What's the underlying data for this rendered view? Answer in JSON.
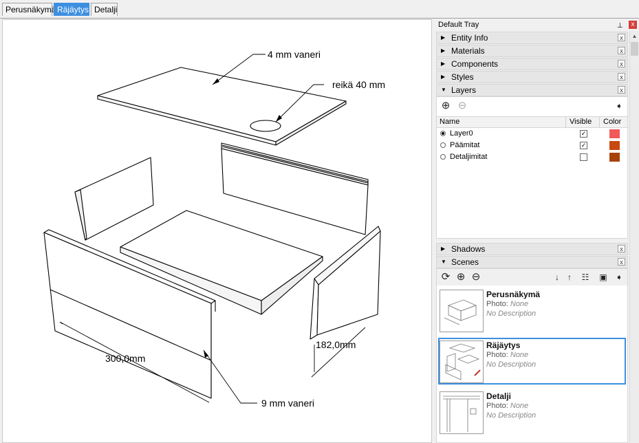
{
  "scene_tabs": [
    {
      "label": "Perusnäkymä",
      "active": false
    },
    {
      "label": "Räjäytys",
      "active": true
    },
    {
      "label": "Detalji",
      "active": false
    }
  ],
  "viewport": {
    "labels": {
      "top_plywood": "4 mm vaneri",
      "hole": "reikä 40 mm",
      "side_plywood": "9 mm vaneri",
      "dim_length": "300,0mm",
      "dim_depth": "182,0mm"
    }
  },
  "tray": {
    "title": "Default Tray",
    "pin_icon": "pin-icon",
    "close_label": "x",
    "panels": {
      "entity_info": "Entity Info",
      "materials": "Materials",
      "components": "Components",
      "styles": "Styles",
      "layers": "Layers",
      "shadows": "Shadows",
      "scenes": "Scenes"
    },
    "panel_close": "x",
    "layers": {
      "columns": {
        "name": "Name",
        "visible": "Visible",
        "color": "Color"
      },
      "rows": [
        {
          "name": "Layer0",
          "current": true,
          "visible": true,
          "color": "#f25a5a"
        },
        {
          "name": "Päämitat",
          "current": false,
          "visible": true,
          "color": "#c84a10"
        },
        {
          "name": "Detaljimitat",
          "current": false,
          "visible": false,
          "color": "#a8430a"
        }
      ]
    },
    "scenes": {
      "photo_label": "Photo:",
      "photo_value": "None",
      "description": "No Description",
      "items": [
        {
          "name": "Perusnäkymä",
          "selected": false
        },
        {
          "name": "Räjäytys",
          "selected": true
        },
        {
          "name": "Detalji",
          "selected": false
        }
      ]
    }
  }
}
